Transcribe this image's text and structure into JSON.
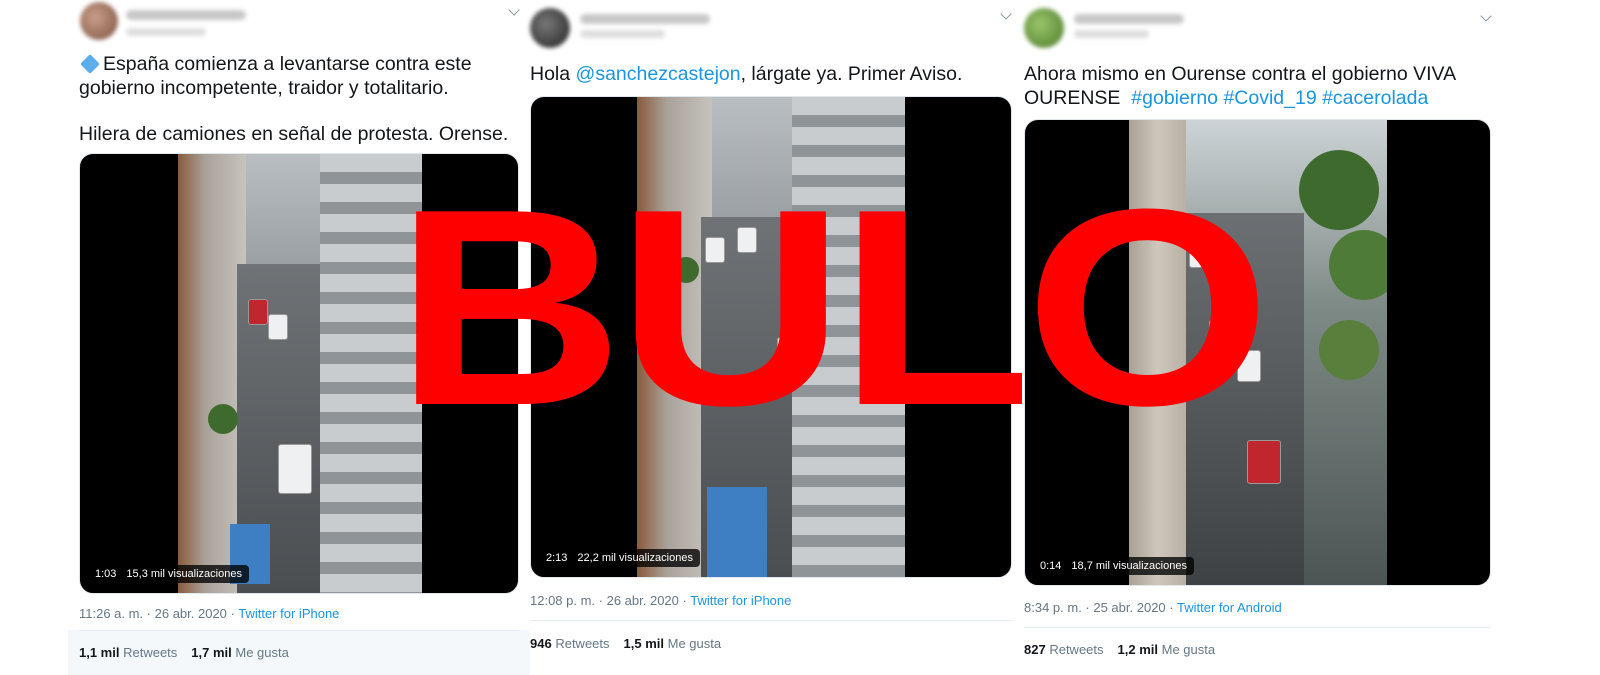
{
  "overlay": {
    "stamp": "BULO",
    "color": "#ff0000"
  },
  "tweets": [
    {
      "text_line1": "España comienza a levantarse contra este",
      "text_line2": "gobierno incompetente, traidor y totalitario.",
      "text_line3": "Hilera de camiones en señal de protesta. Orense.",
      "video": {
        "duration": "1:03",
        "views": "15,3 mil visualizaciones"
      },
      "time": "11:26 a. m. · 26 abr. 2020 ·",
      "source": "Twitter for iPhone",
      "retweets_count": "1,1 mil",
      "retweets_label": "Retweets",
      "likes_count": "1,7 mil",
      "likes_label": "Me gusta"
    },
    {
      "text_pre": "Hola ",
      "mention": "@sanchezcastejon",
      "text_post": ", lárgate ya. Primer Aviso.",
      "video": {
        "duration": "2:13",
        "views": "22,2 mil visualizaciones"
      },
      "time": "12:08 p. m. · 26 abr. 2020 ·",
      "source": "Twitter for iPhone",
      "retweets_count": "946",
      "retweets_label": "Retweets",
      "likes_count": "1,5 mil",
      "likes_label": "Me gusta"
    },
    {
      "text_line1": "Ahora mismo en Ourense contra el gobierno VIVA",
      "text_line2": "OURENSE",
      "hashtags": "#gobierno #Covid_19 #cacerolada",
      "video": {
        "duration": "0:14",
        "views": "18,7 mil visualizaciones"
      },
      "time": "8:34 p. m. · 25 abr. 2020 ·",
      "source": "Twitter for Android",
      "retweets_count": "827",
      "retweets_label": "Retweets",
      "likes_count": "1,2 mil",
      "likes_label": "Me gusta"
    }
  ],
  "colors": {
    "link": "#1b95e0",
    "meta": "#657786"
  }
}
